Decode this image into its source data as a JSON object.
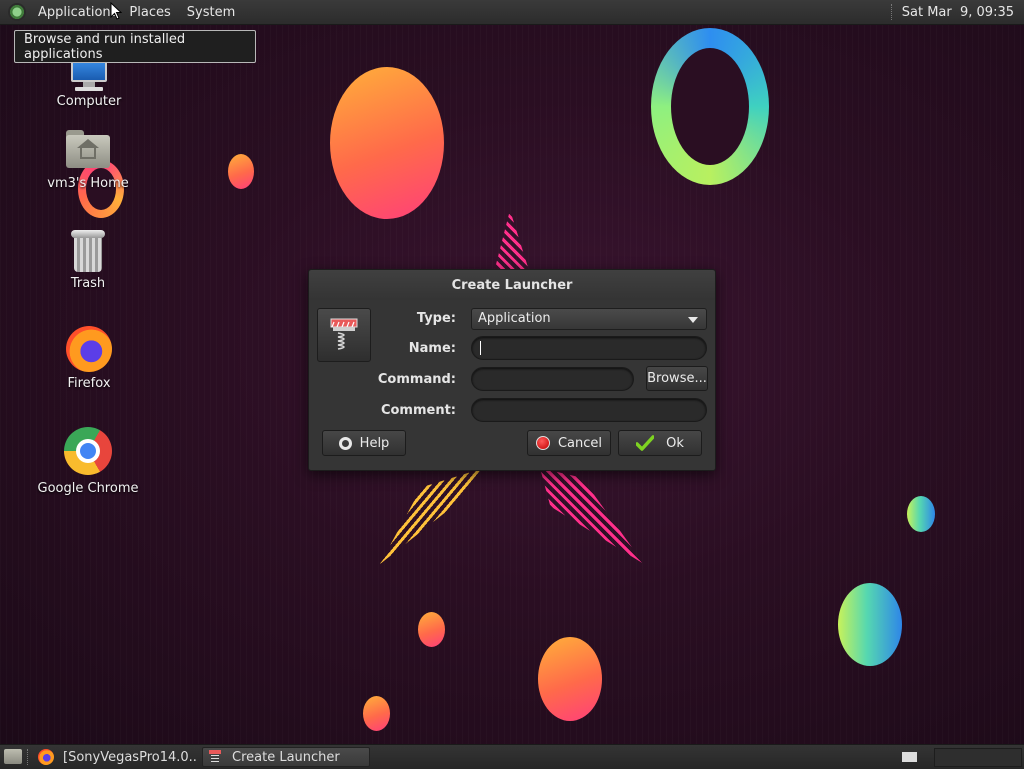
{
  "top_panel": {
    "menus": [
      "Applications",
      "Places",
      "System"
    ],
    "clock": "Sat Mar  9, 09:35"
  },
  "tooltip": "Browse and run installed applications",
  "desktop_icons": [
    {
      "label": "Computer",
      "icon": "computer-icon"
    },
    {
      "label": "vm3's Home",
      "icon": "home-folder-icon"
    },
    {
      "label": "Trash",
      "icon": "trash-icon"
    },
    {
      "label": "Firefox",
      "icon": "firefox-icon"
    },
    {
      "label": "Google Chrome",
      "icon": "chrome-icon"
    }
  ],
  "dialog": {
    "title": "Create Launcher",
    "type_label": "Type:",
    "type_value": "Application",
    "name_label": "Name:",
    "name_value": "",
    "command_label": "Command:",
    "command_value": "",
    "browse_label": "Browse...",
    "comment_label": "Comment:",
    "comment_value": "",
    "help_label": "Help",
    "cancel_label": "Cancel",
    "ok_label": "Ok"
  },
  "taskbar": {
    "tasks": [
      {
        "label": "[SonyVegasPro14.0...",
        "icon": "firefox-icon",
        "active": false
      },
      {
        "label": "Create Launcher",
        "icon": "launcher-icon",
        "active": true
      }
    ]
  },
  "colors": {
    "panel": "#2f2f2f",
    "dialog": "#353535",
    "desktop_bg": "#2a0e22"
  }
}
